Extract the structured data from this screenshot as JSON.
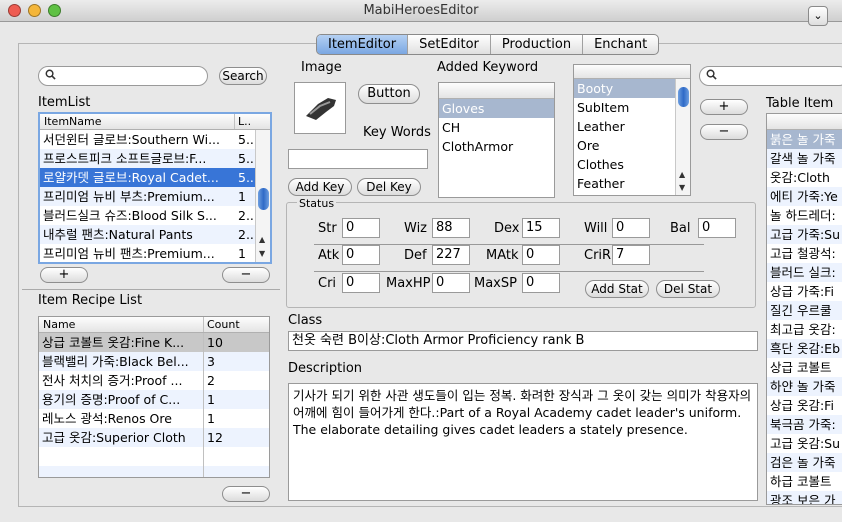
{
  "window": {
    "title": "MabiHeroesEditor"
  },
  "tabs": [
    "ItemEditor",
    "SetEditor",
    "Production",
    "Enchant"
  ],
  "left": {
    "search_button": "Search",
    "itemlist_label": "ItemList",
    "itemlist_headers": [
      "ItemName",
      "L.."
    ],
    "items": [
      {
        "name": "서던윈터 글로브:Southern Wi...",
        "level": "5.."
      },
      {
        "name": "프로스트피크 소프트글로브:F...",
        "level": "5.."
      },
      {
        "name": "로얄카뎃 글로브:Royal Cadet...",
        "level": "5.."
      },
      {
        "name": "프리미엄 뉴비 부츠:Premium...",
        "level": "1"
      },
      {
        "name": "블러드실크 슈즈:Blood Silk S...",
        "level": "2.."
      },
      {
        "name": "내추럴 팬츠:Natural Pants",
        "level": "2.."
      },
      {
        "name": "프리미엄 뉴비 팬츠:Premium...",
        "level": "1"
      }
    ],
    "add": "+",
    "remove": "−",
    "recipe_label": "Item Recipe List",
    "recipe_headers": [
      "Name",
      "Count"
    ],
    "recipes": [
      {
        "name": "상급 코볼트 옷감:Fine K...",
        "count": "10"
      },
      {
        "name": "블랙밸리 가죽:Black Bel...",
        "count": "3"
      },
      {
        "name": "전사 처치의 증거:Proof ...",
        "count": "2"
      },
      {
        "name": "용기의 증명:Proof of C...",
        "count": "1"
      },
      {
        "name": "레노스 광석:Renos Ore",
        "count": "1"
      },
      {
        "name": "고급 옷감:Superior Cloth",
        "count": "12"
      }
    ],
    "recipe_remove": "−"
  },
  "middle": {
    "image_label": "Image",
    "button_label": "Button",
    "keywords_label": "Key Words",
    "keywords_value": "",
    "add_key": "Add Key",
    "del_key": "Del Key",
    "added_keyword_label": "Added Keyword",
    "added_keywords": [
      "Gloves",
      "CH",
      "ClothArmor"
    ],
    "keyword_options": [
      "Booty",
      "SubItem",
      "Leather",
      "Ore",
      "Clothes",
      "Feather"
    ],
    "status_label": "Status",
    "stats_row1": [
      {
        "k": "Str",
        "v": "0"
      },
      {
        "k": "Wiz",
        "v": "88"
      },
      {
        "k": "Dex",
        "v": "15"
      },
      {
        "k": "Will",
        "v": "0"
      },
      {
        "k": "Bal",
        "v": "0"
      }
    ],
    "stats_row2": [
      {
        "k": "Atk",
        "v": "0"
      },
      {
        "k": "Def",
        "v": "227"
      },
      {
        "k": "MAtk",
        "v": "0"
      },
      {
        "k": "CriR",
        "v": "7"
      }
    ],
    "stats_row3": [
      {
        "k": "Cri",
        "v": "0"
      },
      {
        "k": "MaxHP",
        "v": "0"
      },
      {
        "k": "MaxSP",
        "v": "0"
      }
    ],
    "add_stat": "Add Stat",
    "del_stat": "Del Stat",
    "class_label": "Class",
    "class_value": "천옷 숙련 B이상:Cloth Armor Proficiency rank B",
    "description_label": "Description",
    "description": "기사가 되기 위한 사관 생도들이 입는 정복. 화려한 장식과 그 옷이 갖는 의미가 착용자의 어깨에 힘이 들어가게 한다.:Part of a Royal Academy cadet leader's uniform. The elaborate detailing gives cadet leaders a stately presence."
  },
  "right": {
    "add": "+",
    "remove": "−",
    "table_label": "Table Item",
    "table_items": [
      "붉은 놀 가죽",
      "갈색 놀 가죽",
      "옷감:Cloth",
      "에티 가죽:Ye",
      "놀 하드레더:",
      "고급 가죽:Su",
      "고급 철광석:",
      "블러드 실크:",
      "상급 가죽:Fi",
      "질긴 우르쿨",
      "최고급 옷감:",
      "흑단 옷감:Eb",
      "상급 코볼트",
      "하얀 놀 가죽",
      "상급 옷감:Fi",
      "북극곰 가죽:",
      "고급 옷감:Su",
      "검은 놀 가죽",
      "하급 코볼트",
      "광조 보은 가"
    ]
  }
}
